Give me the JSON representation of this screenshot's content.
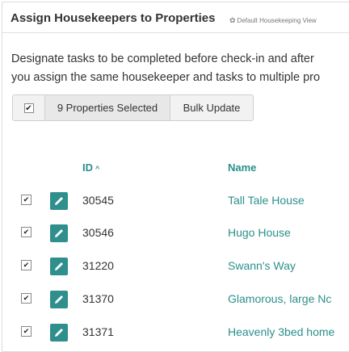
{
  "header": {
    "title": "Assign Housekeepers to Properties",
    "view_label": "Default Housekeeping View",
    "view_icon": "gear-icon"
  },
  "description": {
    "line1": "Designate tasks to be completed before check-in and after",
    "line2": "you assign the same housekeeper and tasks to multiple pro"
  },
  "toolbar": {
    "check_mark": "✔",
    "selected_label": "9 Properties Selected",
    "bulk_label": "Bulk Update"
  },
  "table": {
    "columns": {
      "id": "ID",
      "name": "Name",
      "sort_indicator": "^"
    },
    "rows": [
      {
        "checked": true,
        "id": "30545",
        "name": "Tall Tale House"
      },
      {
        "checked": true,
        "id": "30546",
        "name": "Hugo House"
      },
      {
        "checked": true,
        "id": "31220",
        "name": "Swann's Way"
      },
      {
        "checked": true,
        "id": "31370",
        "name": "Glamorous, large Nc"
      },
      {
        "checked": true,
        "id": "31371",
        "name": "Heavenly 3bed home"
      }
    ]
  },
  "colors": {
    "accent": "#2b8f8c",
    "edit_button": "#2f8f8d",
    "text": "#333333"
  }
}
